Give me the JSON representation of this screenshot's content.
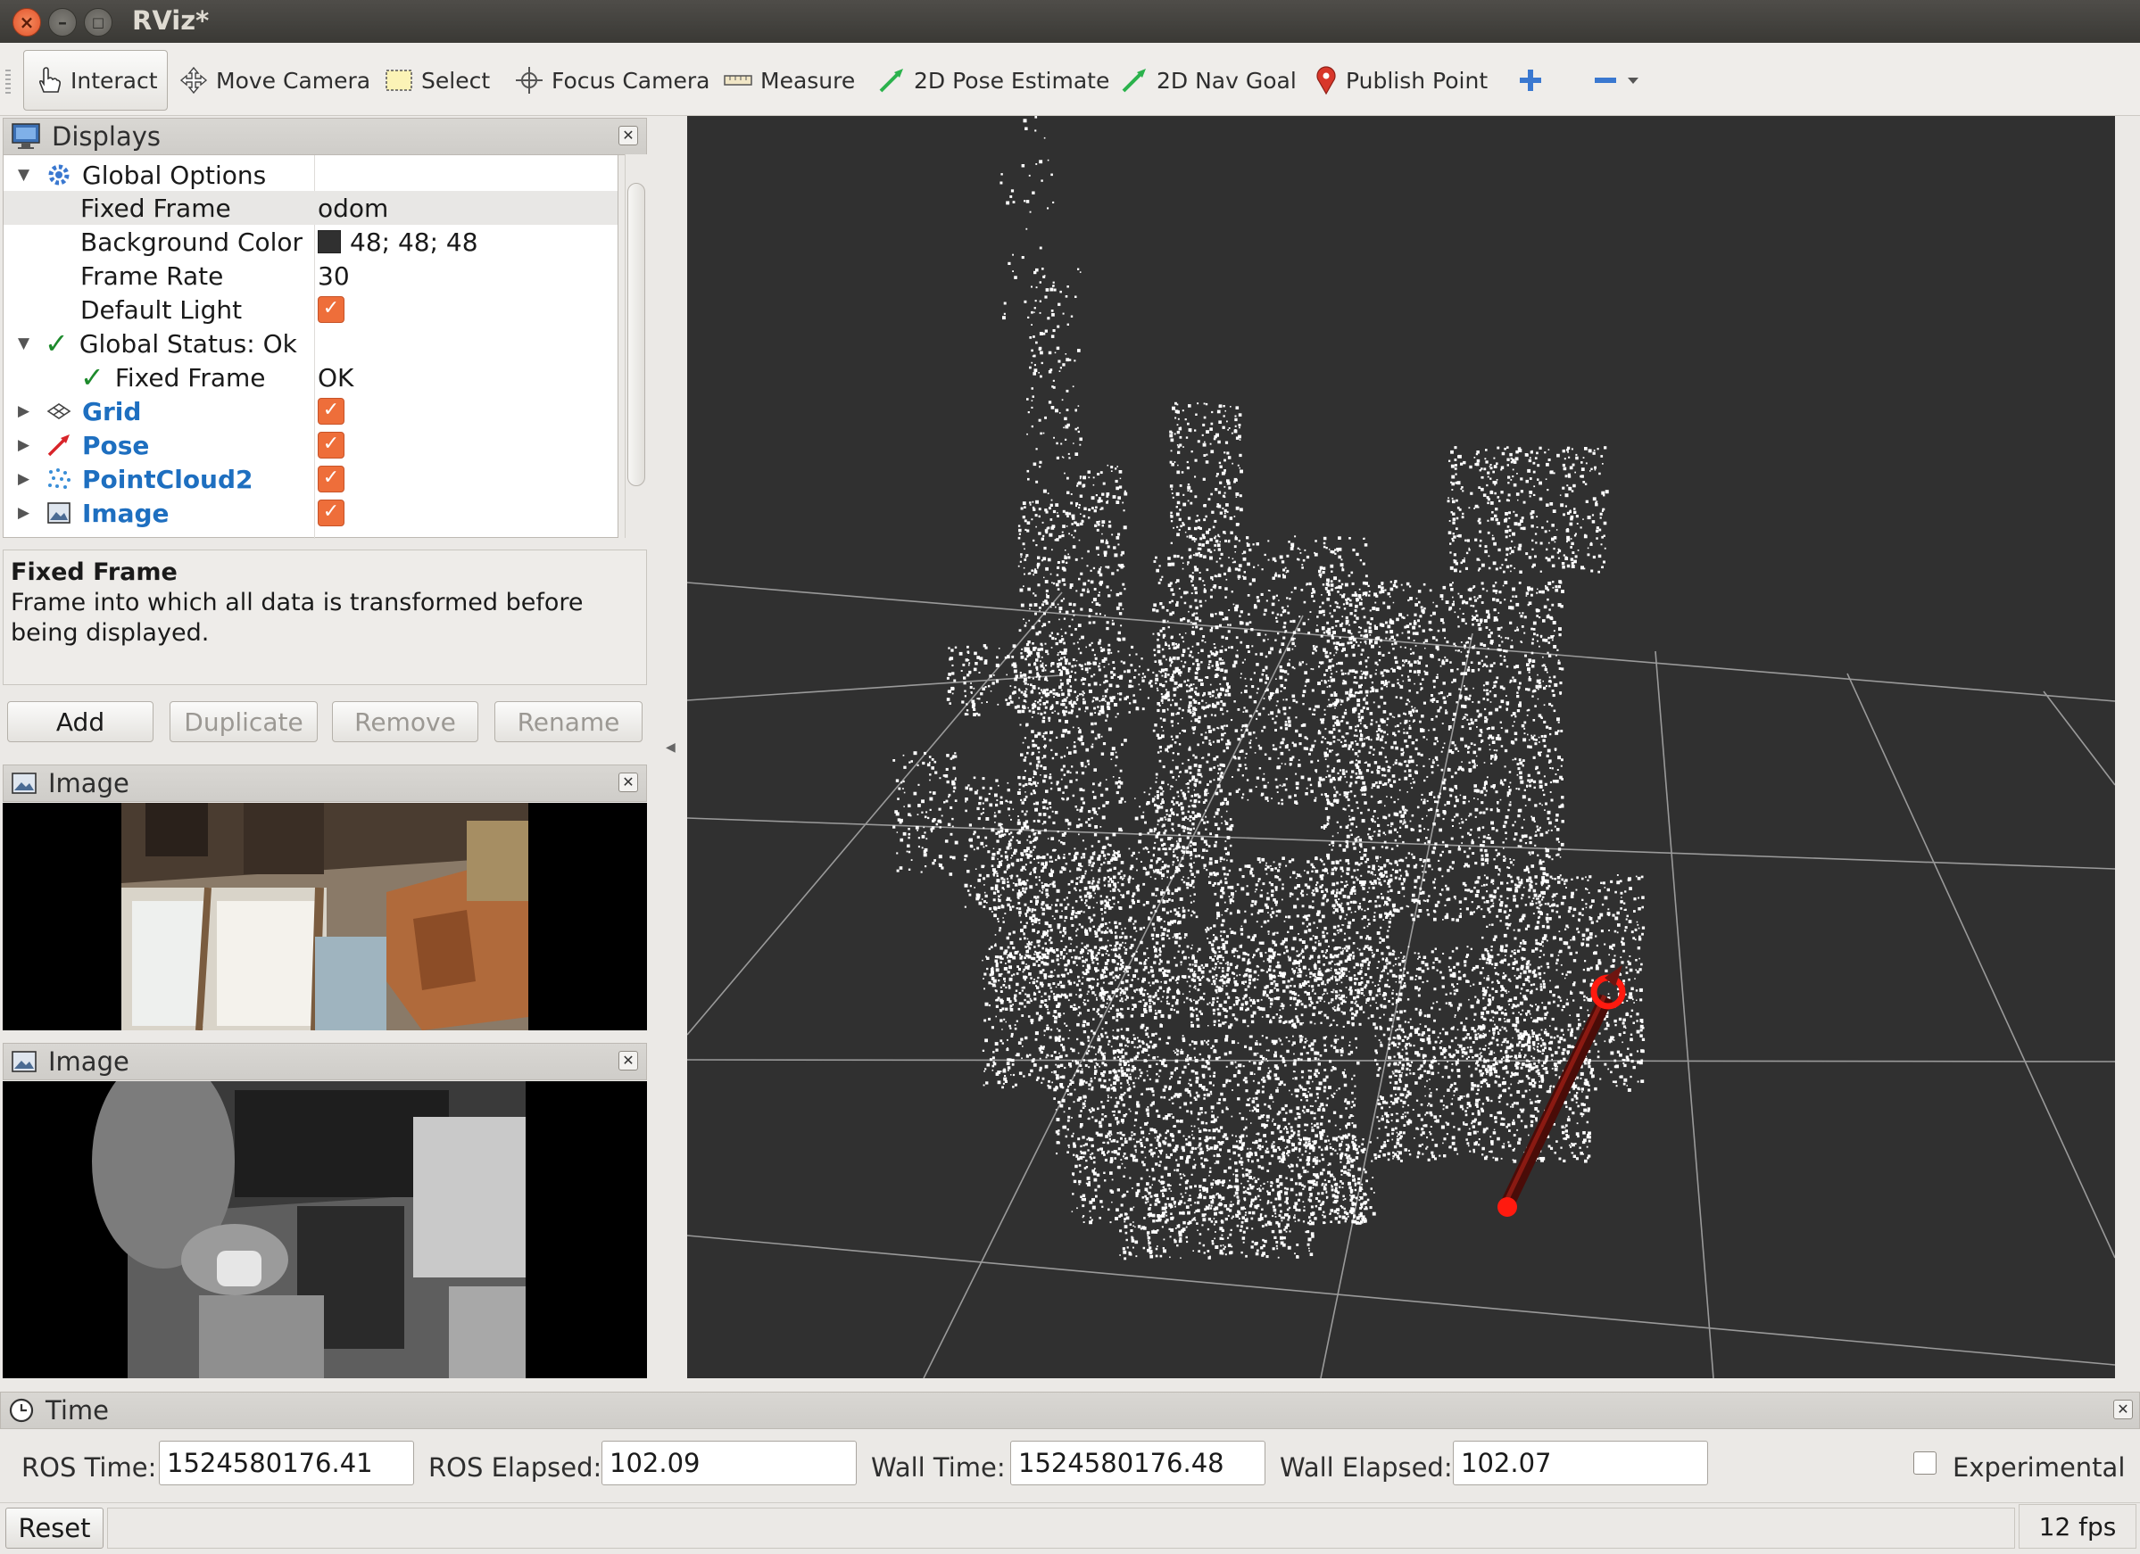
{
  "window": {
    "title": "RViz*"
  },
  "toolbar": {
    "tools": [
      {
        "label": "Interact",
        "icon": "hand-pointer-icon"
      },
      {
        "label": "Move Camera",
        "icon": "move-camera-icon"
      },
      {
        "label": "Select",
        "icon": "select-box-icon"
      },
      {
        "label": "Focus Camera",
        "icon": "focus-camera-icon"
      },
      {
        "label": "Measure",
        "icon": "ruler-icon"
      },
      {
        "label": "2D Pose Estimate",
        "icon": "green-arrow-icon"
      },
      {
        "label": "2D Nav Goal",
        "icon": "green-arrow-icon"
      },
      {
        "label": "Publish Point",
        "icon": "map-pin-icon"
      }
    ]
  },
  "displays": {
    "title": "Displays",
    "rows": {
      "global_options": "Global Options",
      "fixed_frame": {
        "name": "Fixed Frame",
        "value": "odom"
      },
      "background_color": {
        "name": "Background Color",
        "value": "48; 48; 48",
        "swatch": "#303030"
      },
      "frame_rate": {
        "name": "Frame Rate",
        "value": "30"
      },
      "default_light": {
        "name": "Default Light",
        "checked": true
      },
      "global_status": "Global Status: Ok",
      "status_fixed_frame": {
        "name": "Fixed Frame",
        "value": "OK"
      },
      "grid": {
        "name": "Grid",
        "checked": true
      },
      "pose": {
        "name": "Pose",
        "checked": true
      },
      "pointcloud2": {
        "name": "PointCloud2",
        "checked": true
      },
      "image": {
        "name": "Image",
        "checked": true
      }
    },
    "help": {
      "title": "Fixed Frame",
      "text": "Frame into which all data is transformed before being displayed."
    },
    "buttons": {
      "add": "Add",
      "duplicate": "Duplicate",
      "remove": "Remove",
      "rename": "Rename"
    }
  },
  "image_panels": [
    {
      "title": "Image"
    },
    {
      "title": "Image"
    }
  ],
  "time": {
    "title": "Time",
    "ros_time_label": "ROS Time:",
    "ros_time": "1524580176.41",
    "ros_elapsed_label": "ROS Elapsed:",
    "ros_elapsed": "102.09",
    "wall_time_label": "Wall Time:",
    "wall_time": "1524580176.48",
    "wall_elapsed_label": "Wall Elapsed:",
    "wall_elapsed": "102.07",
    "experimental_label": "Experimental",
    "experimental_checked": false
  },
  "status": {
    "reset_label": "Reset",
    "fps": "12 fps"
  },
  "colors": {
    "view_background": "#303030",
    "accent_checkbox": "#ee6e3a",
    "link_blue": "#1e6fc0"
  }
}
